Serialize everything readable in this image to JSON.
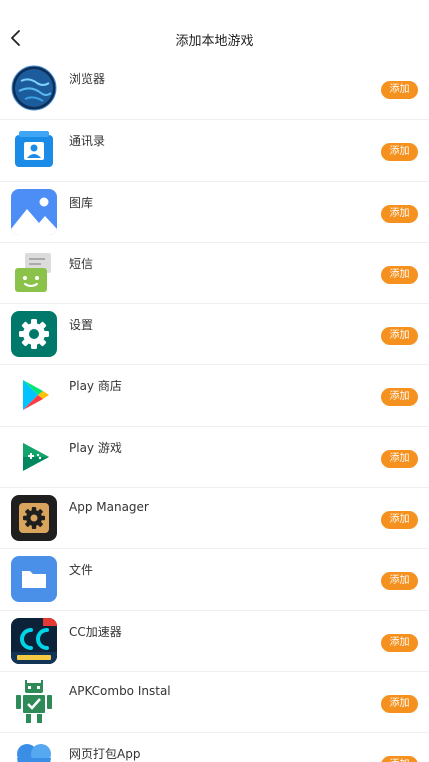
{
  "header": {
    "title": "添加本地游戏",
    "back_icon": "chevron-left-icon"
  },
  "apps": [
    {
      "name": "浏览器",
      "icon": "globe-icon",
      "add_label": "添加"
    },
    {
      "name": "通讯录",
      "icon": "contacts-icon",
      "add_label": "添加"
    },
    {
      "name": "图库",
      "icon": "gallery-icon",
      "add_label": "添加"
    },
    {
      "name": "短信",
      "icon": "messaging-icon",
      "add_label": "添加"
    },
    {
      "name": "设置",
      "icon": "settings-gear-icon",
      "add_label": "添加"
    },
    {
      "name": "Play 商店",
      "icon": "play-store-icon",
      "add_label": "添加"
    },
    {
      "name": "Play 游戏",
      "icon": "play-games-icon",
      "add_label": "添加"
    },
    {
      "name": "App Manager",
      "icon": "app-manager-icon",
      "add_label": "添加"
    },
    {
      "name": "文件",
      "icon": "folder-icon",
      "add_label": "添加"
    },
    {
      "name": "CC加速器",
      "icon": "cc-accelerator-icon",
      "add_label": "添加"
    },
    {
      "name": "APKCombo Instal",
      "icon": "android-robot-icon",
      "add_label": "添加"
    },
    {
      "name": "网页打包App",
      "icon": "web-pack-icon",
      "add_label": "添加"
    }
  ],
  "colors": {
    "accent": "#f5911e",
    "divider": "#efefef"
  }
}
